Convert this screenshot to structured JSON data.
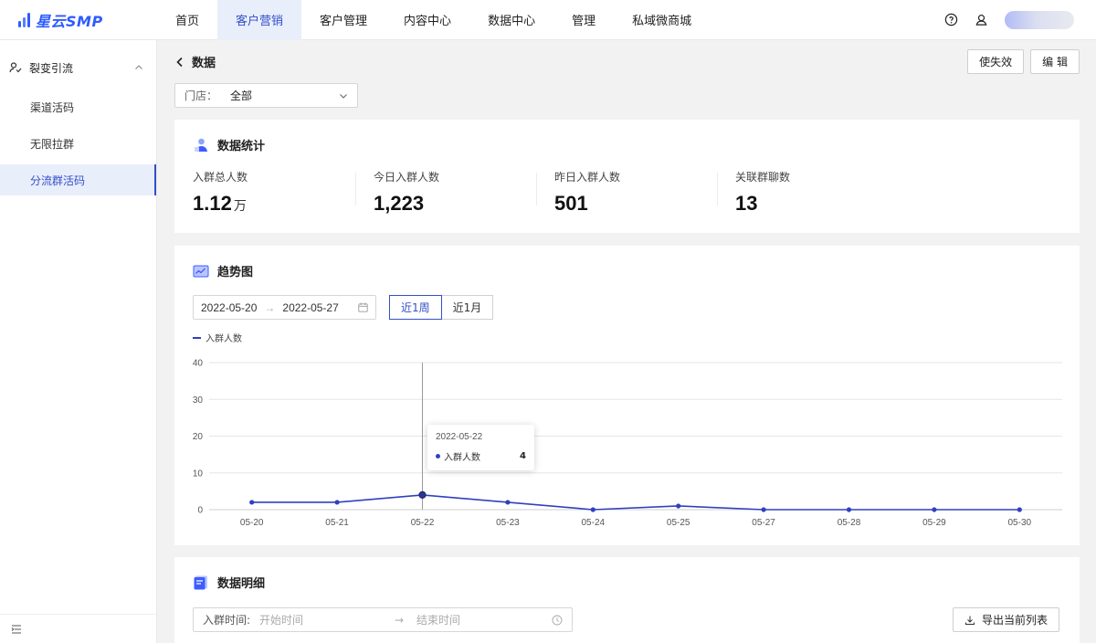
{
  "app": {
    "logo_text": "星云SMP",
    "brand_color": "#2e5bff",
    "accent_color": "#3450c8"
  },
  "nav": {
    "items": [
      {
        "label": "首页"
      },
      {
        "label": "客户营销",
        "active": true
      },
      {
        "label": "客户管理"
      },
      {
        "label": "内容中心"
      },
      {
        "label": "数据中心"
      },
      {
        "label": "管理"
      },
      {
        "label": "私域微商城"
      }
    ],
    "icons": [
      "help-icon",
      "user-icon"
    ]
  },
  "sidebar": {
    "group_label": "裂变引流",
    "items": [
      {
        "label": "渠道活码"
      },
      {
        "label": "无限拉群"
      },
      {
        "label": "分流群活码",
        "active": true
      }
    ]
  },
  "page": {
    "title": "数据",
    "btn_invalidate": "使失效",
    "btn_edit": "编 辑",
    "store_label": "门店：",
    "store_value": "全部"
  },
  "stats_card": {
    "title": "数据统计",
    "items": [
      {
        "label": "入群总人数",
        "value": "1.12",
        "unit": "万"
      },
      {
        "label": "今日入群人数",
        "value": "1,223",
        "unit": ""
      },
      {
        "label": "昨日入群人数",
        "value": "501",
        "unit": ""
      },
      {
        "label": "关联群聊数",
        "value": "13",
        "unit": ""
      }
    ]
  },
  "trend_card": {
    "title": "趋势图",
    "date_start": "2022-05-20",
    "date_end": "2022-05-27",
    "range_week": "近1周",
    "range_month": "近1月",
    "tooltip": {
      "date": "2022-05-22",
      "series": "入群人数",
      "value": "4"
    }
  },
  "chart_data": {
    "type": "line",
    "categories": [
      "05-20",
      "05-21",
      "05-22",
      "05-23",
      "05-24",
      "05-25",
      "05-27",
      "05-28",
      "05-29",
      "05-30"
    ],
    "series": [
      {
        "name": "入群人数",
        "values": [
          2,
          2,
          4,
          2,
          0,
          1,
          0,
          0,
          0,
          0
        ],
        "color": "#3040c0"
      }
    ],
    "ylim": [
      0,
      40
    ],
    "yticks": [
      0,
      10,
      20,
      30,
      40
    ],
    "grid": true,
    "legend": "top-left",
    "highlight_index": 2
  },
  "detail_card": {
    "title": "数据明细",
    "filter_label": "入群时间:",
    "start_placeholder": "开始时间",
    "end_placeholder": "结束时间",
    "export_label": "导出当前列表"
  }
}
